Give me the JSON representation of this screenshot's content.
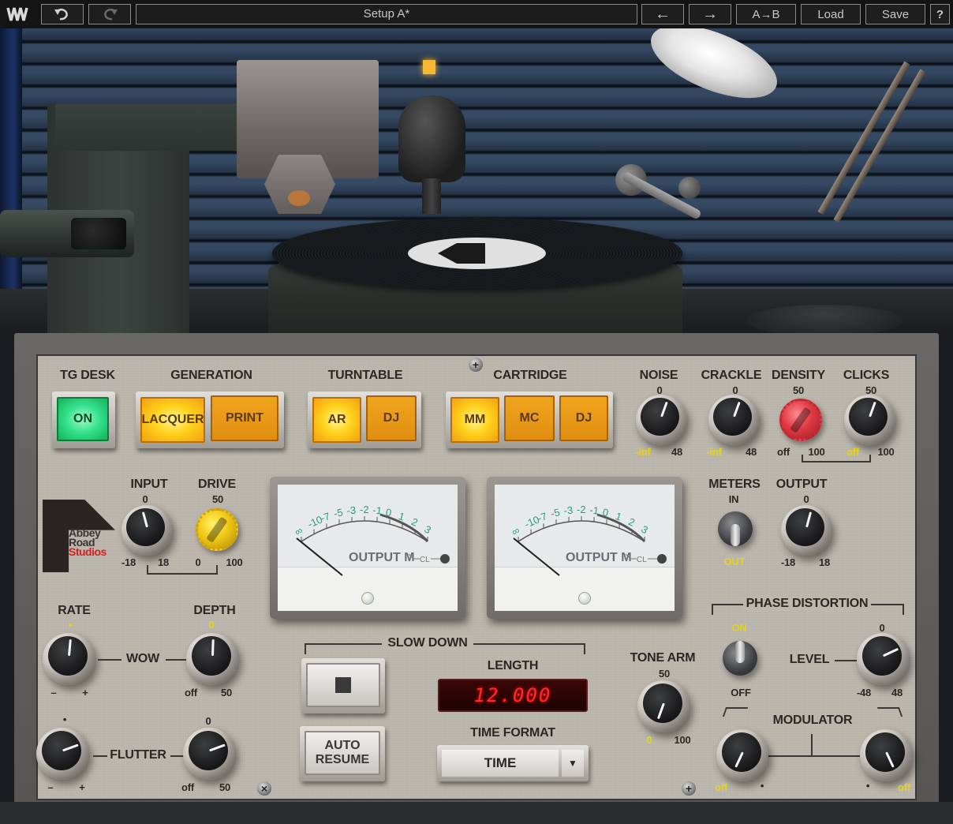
{
  "toolbar": {
    "logo": "waves-logo",
    "undo_icon": "undo-icon",
    "redo_icon": "redo-icon",
    "preset_name": "Setup A*",
    "prev_icon": "←",
    "next_icon": "→",
    "ab_label": "A→B",
    "load_label": "Load",
    "save_label": "Save",
    "help_label": "?"
  },
  "scene": {
    "description": "Record cutting lathe with turntable and desk lamp"
  },
  "panel": {
    "tg_desk": {
      "label": "TG DESK",
      "button": "ON",
      "state": "on"
    },
    "generation": {
      "label": "GENERATION",
      "options": [
        "LACQUER",
        "PRINT"
      ],
      "selected": "LACQUER"
    },
    "turntable": {
      "label": "TURNTABLE",
      "options": [
        "AR",
        "DJ"
      ],
      "selected": "AR"
    },
    "cartridge": {
      "label": "CARTRIDGE",
      "options": [
        "MM",
        "MC",
        "DJ"
      ],
      "selected": "MM"
    },
    "noise": {
      "label": "NOISE",
      "center": "0",
      "min": "-inf",
      "max": "48"
    },
    "crackle": {
      "label": "CRACKLE",
      "center": "0",
      "min": "-inf",
      "max": "48"
    },
    "density": {
      "label": "DENSITY",
      "center": "50",
      "min": "off",
      "max": "100"
    },
    "clicks": {
      "label": "CLICKS",
      "center": "50",
      "min": "off",
      "max": "100"
    },
    "logo": {
      "line1": "Abbey",
      "line2": "Road",
      "line3": "Studios"
    },
    "input": {
      "label": "INPUT",
      "center": "0",
      "min": "-18",
      "max": "18"
    },
    "drive": {
      "label": "DRIVE",
      "center": "50",
      "min": "0",
      "max": "100"
    },
    "meter_left": {
      "scale": [
        "∞",
        "-10",
        "-7",
        "-5",
        "-3",
        "-2",
        "-1",
        "0",
        "1",
        "2",
        "3"
      ],
      "caption": "OUTPUT M",
      "clip": "CL"
    },
    "meter_right": {
      "scale": [
        "∞",
        "-10",
        "-7",
        "-5",
        "-3",
        "-2",
        "-1",
        "0",
        "1",
        "2",
        "3"
      ],
      "caption": "OUTPUT M",
      "clip": "CL"
    },
    "meters": {
      "label": "METERS",
      "top": "IN",
      "bottom": "OUT",
      "state": "out"
    },
    "output": {
      "label": "OUTPUT",
      "center": "0",
      "min": "-18",
      "max": "18"
    },
    "wow": {
      "label": "WOW",
      "rate_label": "RATE",
      "rate_center": "•",
      "rate_min": "–",
      "rate_max": "+",
      "depth_label": "DEPTH",
      "depth_center": "0",
      "depth_min": "off",
      "depth_max": "50"
    },
    "flutter": {
      "label": "FLUTTER",
      "rate_center": "•",
      "rate_min": "–",
      "rate_max": "+",
      "depth_center": "0",
      "depth_min": "off",
      "depth_max": "50"
    },
    "slow_down": {
      "label": "SLOW DOWN",
      "stop_icon": "stop-icon",
      "auto_resume_line1": "AUTO",
      "auto_resume_line2": "RESUME",
      "length_label": "LENGTH",
      "length_value": "12.000",
      "time_format_label": "TIME FORMAT",
      "time_format_value": "TIME",
      "dropdown_arrow": "▼"
    },
    "tone_arm": {
      "label": "TONE ARM",
      "center": "50",
      "min": "0",
      "max": "100"
    },
    "phase_distortion": {
      "label": "PHASE DISTORTION",
      "switch_on": "ON",
      "switch_off": "OFF",
      "state": "on",
      "level_label": "LEVEL",
      "level_center": "0",
      "level_min": "-48",
      "level_max": "48",
      "modulator_label": "MODULATOR",
      "mod_left_min": "off",
      "mod_left_max": "•",
      "mod_right_min": "•",
      "mod_right_max": "off"
    }
  }
}
